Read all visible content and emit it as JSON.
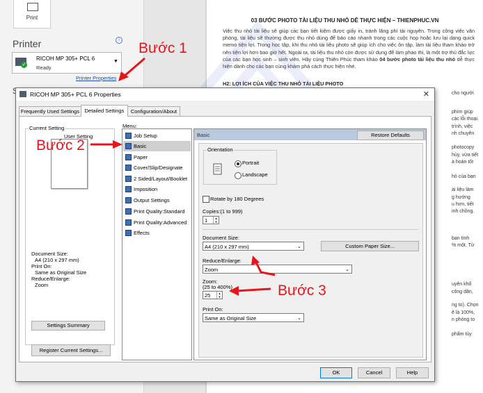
{
  "backstage": {
    "print_label": "Print",
    "printer_heading": "Printer",
    "printer_name": "RICOH MP 305+ PCL 6",
    "printer_status": "Ready",
    "printer_properties_link": "Printer Properties",
    "settings_letter": "S"
  },
  "document": {
    "title": "03 BƯỚC PHOTO TÀI LIỆU THU NHỎ DỄ THỰC HIỆN – THIENPHUC.VN",
    "intro": "Việc thu nhỏ tài liệu sẽ giúp các bạn tiết kiệm được giấy in, tránh lãng phí tài nguyên. Trong công việc văn phòng, tài liệu sẽ thường được thu nhỏ dùng để báo cáo nhanh trong các cuộc họp hoặc lưu lại dạng quick memo tiện lợi. Trong học tập, khi thu nhỏ tài liệu photo sẽ giúp ích cho việc ôn tập, làm tài liệu tham khảo trở nên tiện lợi hơn bao giờ hết. Ngoài ra, tài liệu thu nhỏ còn được sử dụng để làm phao thi, là một trợ thủ đắc lực của các bạn học sinh – sinh viên. Hãy cùng Thiên Phúc tham khảo",
    "intro_bold": "04 bước photo tài liệu thu nhỏ",
    "intro_end": "dễ thực hiện dành cho các bạn cùng khám phá cách thực hiện nhé.",
    "h2": "H2: LỢI ÍCH CỦA VIỆC THU NHỎ TÀI LIỆU PHOTO",
    "fragments": [
      "cho người",
      "phím giúp",
      "các lỗi thoại.",
      "trình, việc",
      "nh chuyên",
      "photocopy",
      "hủy, vừa tiết",
      "à hoàn tốt",
      "hỏ của bạn",
      "ài liệu làm",
      "g hướng",
      "u hơn, tiết",
      "inh chồng.",
      "bạn tính",
      "% một. Từ",
      "uyên khổ",
      "công dân,",
      "ng to). Chọn",
      "ẽ là 100%,",
      "n phóng to",
      "phẩm tùy"
    ]
  },
  "annotations": {
    "step1": "Bước 1",
    "step2": "Bước 2",
    "step3": "Bước 3"
  },
  "dialog": {
    "title": "RICOH MP 305+ PCL 6 Properties",
    "close": "✕",
    "tabs": [
      "Frequently Used Settings",
      "Detailed Settings",
      "Configuration/About"
    ],
    "current_setting": {
      "title": "Current Setting",
      "preview_label": "User Setting",
      "doc_size_label": "Document Size:",
      "doc_size_value": "A4 (210 x 297 mm)",
      "print_on_label": "Print On:",
      "print_on_value": "Same as Original Size",
      "reduce_label": "Reduce/Enlarge:",
      "reduce_value": "Zoom",
      "summary_button": "Settings Summary"
    },
    "register_button": "Register Current Settings...",
    "menu_label": "Menu:",
    "menu_items": [
      "Job Setup",
      "Basic",
      "Paper",
      "Cover/Slip/Designate",
      "2 Sided/Layout/Booklet",
      "Imposition",
      "Output Settings",
      "Print Quality:Standard",
      "Print Quality:Advanced",
      "Effects"
    ],
    "panel": {
      "header": "Basic",
      "restore_button": "Restore Defaults",
      "orientation_label": "Orientation",
      "portrait": "Portrait",
      "landscape": "Landscape",
      "rotate_label": "Rotate by 180 Degrees",
      "copies_label": "Copies:(1 to 999)",
      "copies_value": "1",
      "document_size_label": "Document Size:",
      "document_size_value": "A4 (210 x 297 mm)",
      "custom_paper_button": "Custom Paper Size...",
      "reduce_label": "Reduce/Enlarge:",
      "reduce_value": "Zoom",
      "zoom_label": "Zoom:",
      "zoom_range": "(25 to 400%)",
      "zoom_value": "25",
      "print_on_label": "Print On:",
      "print_on_value": "Same as Original Size"
    },
    "buttons": {
      "ok": "OK",
      "cancel": "Cancel",
      "help": "Help"
    }
  }
}
